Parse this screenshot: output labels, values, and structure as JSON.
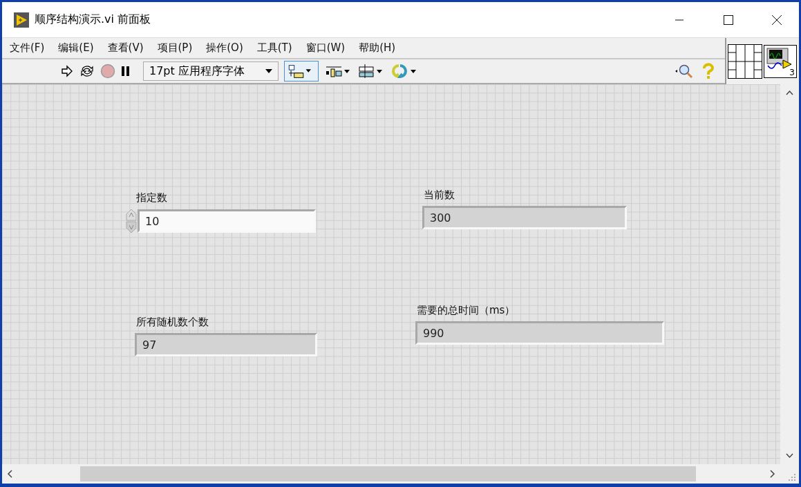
{
  "window": {
    "title": "顺序结构演示.vi 前面板"
  },
  "menu": [
    "文件(F)",
    "编辑(E)",
    "查看(V)",
    "项目(P)",
    "操作(O)",
    "工具(T)",
    "窗口(W)",
    "帮助(H)"
  ],
  "toolbar": {
    "font": "17pt 应用程序字体"
  },
  "connector_pane": {
    "terminal_count": "3"
  },
  "controls": [
    {
      "kind": "control",
      "label": "指定数",
      "value": "10"
    },
    {
      "kind": "indicator",
      "label": "当前数",
      "value": "300"
    },
    {
      "kind": "indicator",
      "label": "所有随机数个数",
      "value": "97"
    },
    {
      "kind": "indicator",
      "label": "需要的总时间（ms）",
      "value": "990"
    }
  ]
}
